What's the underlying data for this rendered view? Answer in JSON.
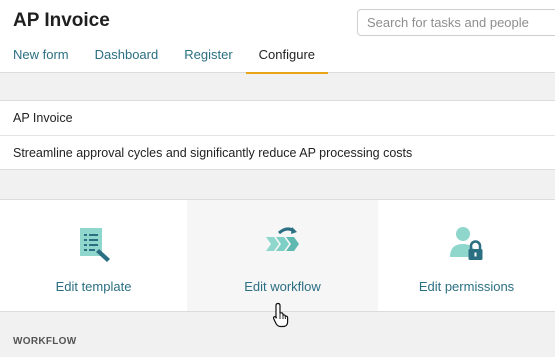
{
  "header": {
    "title": "AP Invoice",
    "search_placeholder": "Search for tasks and people"
  },
  "tabs": [
    {
      "label": "New form"
    },
    {
      "label": "Dashboard"
    },
    {
      "label": "Register"
    },
    {
      "label": "Configure",
      "active": true
    }
  ],
  "info": {
    "name": "AP Invoice",
    "description": "Streamline approval cycles and significantly reduce AP processing costs"
  },
  "cards": [
    {
      "label": "Edit template",
      "icon": "edit-template-icon"
    },
    {
      "label": "Edit workflow",
      "icon": "edit-workflow-icon"
    },
    {
      "label": "Edit permissions",
      "icon": "edit-permissions-icon"
    }
  ],
  "section": {
    "title": "WORKFLOW"
  },
  "colors": {
    "accent": "#2b6f82",
    "icon_teal": "#7ecfc6",
    "active_tab_underline": "#e8a317"
  }
}
